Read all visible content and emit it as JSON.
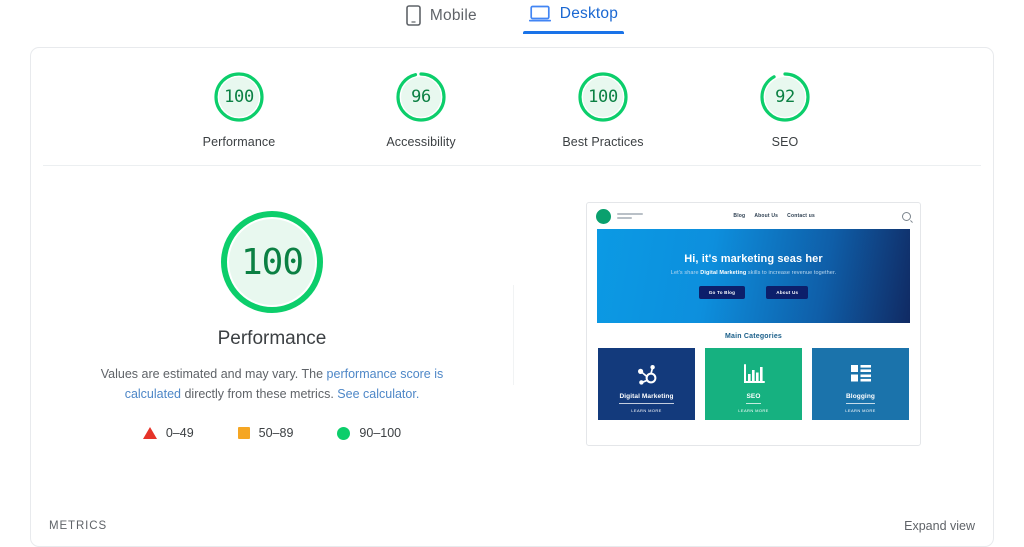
{
  "tabs": [
    {
      "id": "mobile",
      "label": "Mobile",
      "icon": "mobile-phone-icon",
      "active": false
    },
    {
      "id": "desktop",
      "label": "Desktop",
      "icon": "desktop-monitor-icon",
      "active": true
    }
  ],
  "scores": [
    {
      "value": "100",
      "numeric": 100,
      "label": "Performance"
    },
    {
      "value": "96",
      "numeric": 96,
      "label": "Accessibility"
    },
    {
      "value": "100",
      "numeric": 100,
      "label": "Best Practices"
    },
    {
      "value": "92",
      "numeric": 92,
      "label": "SEO"
    }
  ],
  "detail": {
    "score": "100",
    "numeric": 100,
    "title": "Performance",
    "disclaimer_part1": "Values are estimated and may vary. The ",
    "disclaimer_link1": "performance score is calculated",
    "disclaimer_part2": "directly from these metrics. ",
    "disclaimer_link2": "See calculator."
  },
  "legend": [
    {
      "shape": "triangle",
      "range": "0–49",
      "color": "#e63329"
    },
    {
      "shape": "square",
      "range": "50–89",
      "color": "#f5a623"
    },
    {
      "shape": "circle",
      "range": "90–100",
      "color": "#0cce6b"
    }
  ],
  "thumbnail": {
    "nav_links": [
      "Blog",
      "About Us",
      "Contact us"
    ],
    "search_icon": "search-icon",
    "hero_title": "Hi, it's marketing seas her",
    "hero_sub_pre": "Let's share ",
    "hero_sub_bold": "Digital Marketing",
    "hero_sub_post": " skills to increase revenue together.",
    "hero_buttons": [
      "Go To Blog",
      "About Us"
    ],
    "categories_title": "Main Categories",
    "cards": [
      {
        "name": "Digital Marketing",
        "cta": "LEARN MORE",
        "color": "#133a7c",
        "icon": "sprocket-icon"
      },
      {
        "name": "SEO",
        "cta": "LEARN MORE",
        "color": "#16b180",
        "icon": "bar-chart-icon"
      },
      {
        "name": "Blogging",
        "cta": "LEARN MORE",
        "color": "#1b73ab",
        "icon": "list-layout-icon"
      }
    ]
  },
  "footer": {
    "metrics_label": "METRICS",
    "expand_view": "Expand view"
  },
  "colors": {
    "pass_green": "#0cce6b",
    "pass_green_dark": "#0b8043",
    "gauge_bg": "#e8f8ef",
    "accent_blue": "#1a73e8",
    "link_blue": "#4e87c7"
  }
}
